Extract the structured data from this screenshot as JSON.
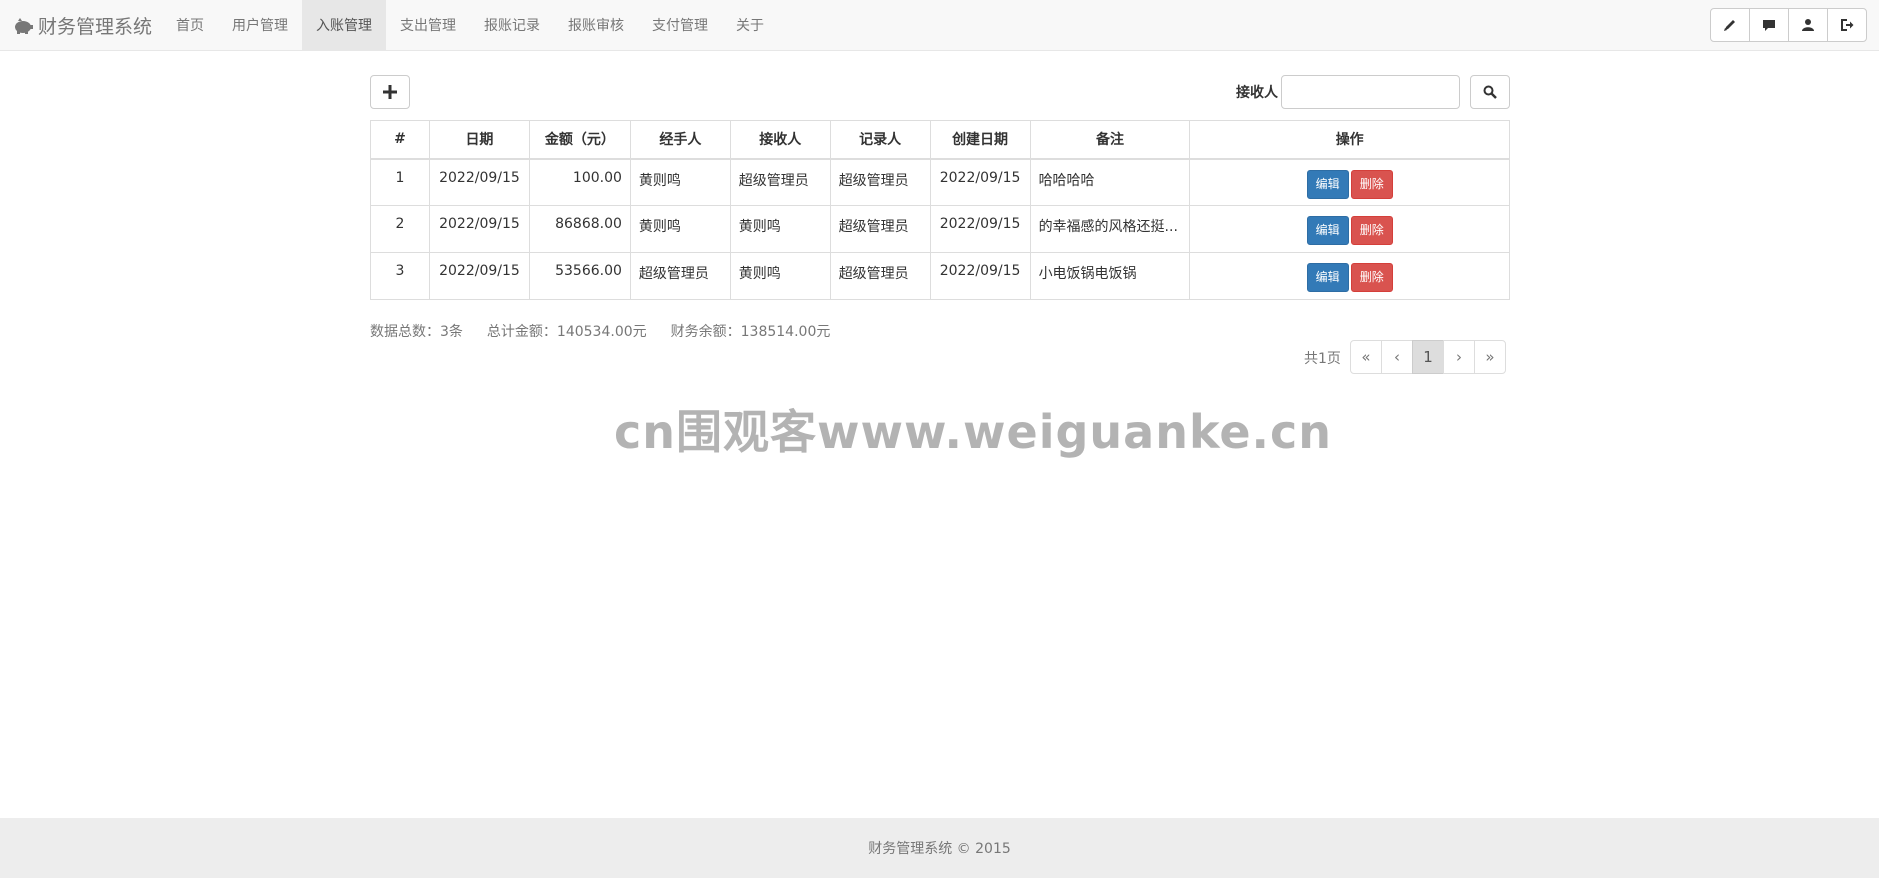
{
  "navbar": {
    "brand": "财务管理系统",
    "items": [
      {
        "label": "首页",
        "active": false
      },
      {
        "label": "用户管理",
        "active": false
      },
      {
        "label": "入账管理",
        "active": true
      },
      {
        "label": "支出管理",
        "active": false
      },
      {
        "label": "报账记录",
        "active": false
      },
      {
        "label": "报账审核",
        "active": false
      },
      {
        "label": "支付管理",
        "active": false
      },
      {
        "label": "关于",
        "active": false
      }
    ],
    "right_icons": [
      "pencil-icon",
      "comment-icon",
      "user-icon",
      "logout-icon"
    ]
  },
  "toolbar": {
    "add_icon": "plus-icon",
    "search_label": "接收人",
    "search_value": "",
    "search_icon": "search-icon"
  },
  "table": {
    "headers": [
      "#",
      "日期",
      "金额（元）",
      "经手人",
      "接收人",
      "记录人",
      "创建日期",
      "备注",
      "操作"
    ],
    "rows": [
      {
        "no": "1",
        "date": "2022/09/15",
        "amount": "100.00",
        "handler": "黄则鸣",
        "receiver": "超级管理员",
        "recorder": "超级管理员",
        "created": "2022/09/15",
        "remark": "哈哈哈哈"
      },
      {
        "no": "2",
        "date": "2022/09/15",
        "amount": "86868.00",
        "handler": "黄则鸣",
        "receiver": "黄则鸣",
        "recorder": "超级管理员",
        "created": "2022/09/15",
        "remark": "的幸福感的风格还挺..."
      },
      {
        "no": "3",
        "date": "2022/09/15",
        "amount": "53566.00",
        "handler": "超级管理员",
        "receiver": "黄则鸣",
        "recorder": "超级管理员",
        "created": "2022/09/15",
        "remark": "小电饭锅电饭锅"
      }
    ],
    "edit_label": "编辑",
    "delete_label": "删除"
  },
  "summary": {
    "count": "数据总数：3条",
    "total": "总计金额：140534.00元",
    "balance": "财务余额：138514.00元"
  },
  "pager": {
    "total_pages": "共1页",
    "first": "«",
    "prev": "‹",
    "current": "1",
    "next": "›",
    "last": "»"
  },
  "watermark": "cn围观客www.weiguanke.cn",
  "footer": "财务管理系统 © 2015",
  "colors": {
    "edit_button": "#337ab7",
    "delete_button": "#d9534f",
    "navbar_bg": "#f8f8f8",
    "active_tab_bg": "#e7e7e7"
  }
}
